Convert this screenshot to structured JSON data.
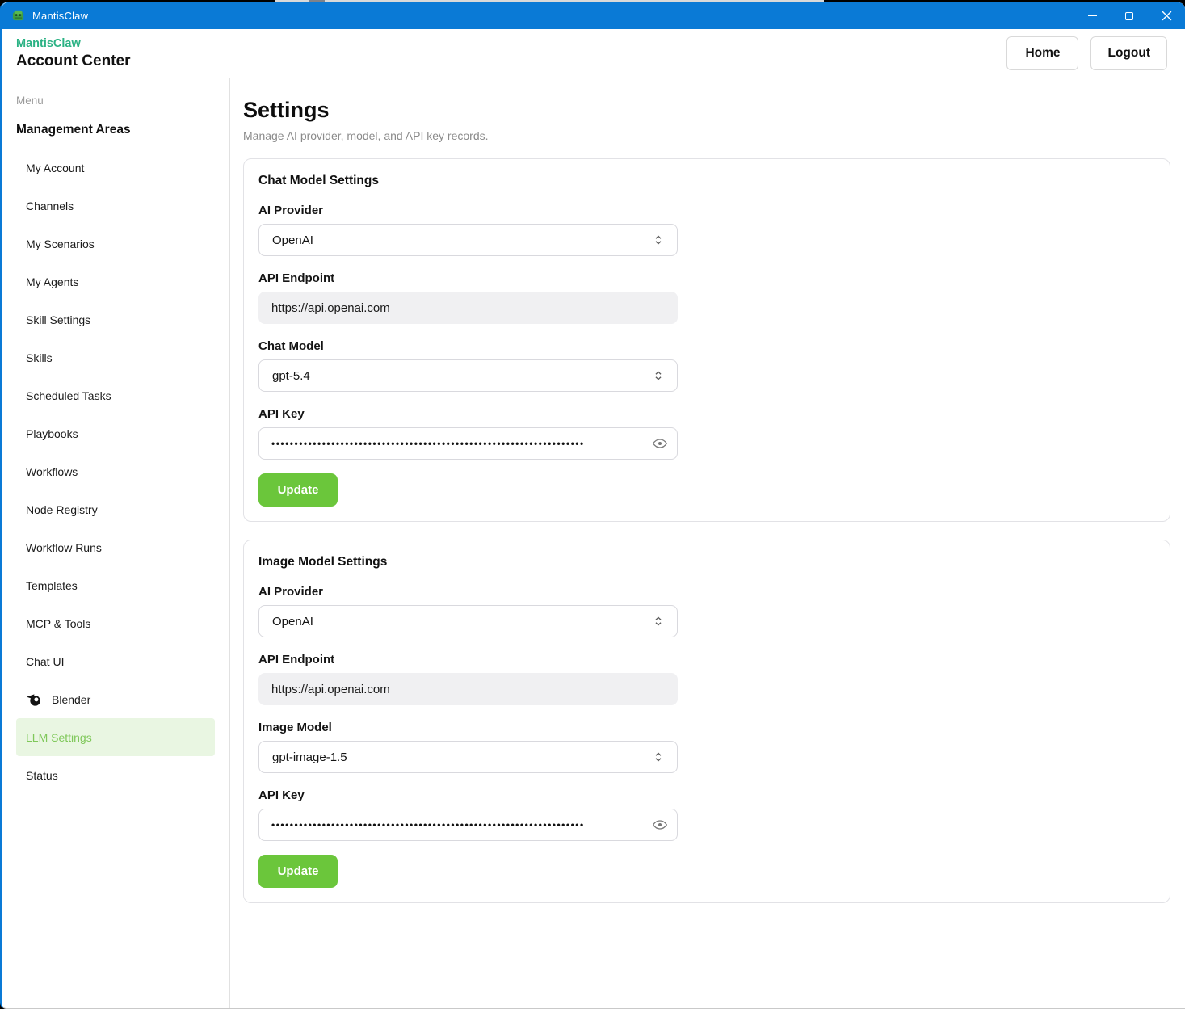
{
  "window": {
    "app_title": "MantisClaw"
  },
  "header": {
    "brand": "MantisClaw",
    "title": "Account Center",
    "home_button": "Home",
    "logout_button": "Logout"
  },
  "sidebar": {
    "menu_label": "Menu",
    "section_title": "Management Areas",
    "items": [
      {
        "label": "My Account"
      },
      {
        "label": "Channels"
      },
      {
        "label": "My Scenarios"
      },
      {
        "label": "My Agents"
      },
      {
        "label": "Skill Settings"
      },
      {
        "label": "Skills"
      },
      {
        "label": "Scheduled Tasks"
      },
      {
        "label": "Playbooks"
      },
      {
        "label": "Workflows"
      },
      {
        "label": "Node Registry"
      },
      {
        "label": "Workflow Runs"
      },
      {
        "label": "Templates"
      },
      {
        "label": "MCP & Tools"
      },
      {
        "label": "Chat UI"
      },
      {
        "label": "Blender",
        "icon": "blender-icon"
      },
      {
        "label": "LLM Settings",
        "active": true
      },
      {
        "label": "Status"
      }
    ]
  },
  "main": {
    "title": "Settings",
    "subtitle": "Manage AI provider, model, and API key records.",
    "cards": [
      {
        "title": "Chat Model Settings",
        "provider_label": "AI Provider",
        "provider_value": "OpenAI",
        "endpoint_label": "API Endpoint",
        "endpoint_value": "https://api.openai.com",
        "model_label": "Chat Model",
        "model_value": "gpt-5.4",
        "key_label": "API Key",
        "key_masked": "••••••••••••••••••••••••••••••••••••••••••••••••••••••••••••••••••••",
        "update_button": "Update"
      },
      {
        "title": "Image Model Settings",
        "provider_label": "AI Provider",
        "provider_value": "OpenAI",
        "endpoint_label": "API Endpoint",
        "endpoint_value": "https://api.openai.com",
        "model_label": "Image Model",
        "model_value": "gpt-image-1.5",
        "key_label": "API Key",
        "key_masked": "••••••••••••••••••••••••••••••••••••••••••••••••••••••••••••••••••••",
        "update_button": "Update"
      }
    ]
  },
  "colors": {
    "titlebar_blue": "#0a7ad6",
    "brand_green": "#2bb284",
    "active_item_bg": "#e9f6e2",
    "active_item_text": "#7fc85a",
    "update_button_green": "#6bc63b"
  }
}
